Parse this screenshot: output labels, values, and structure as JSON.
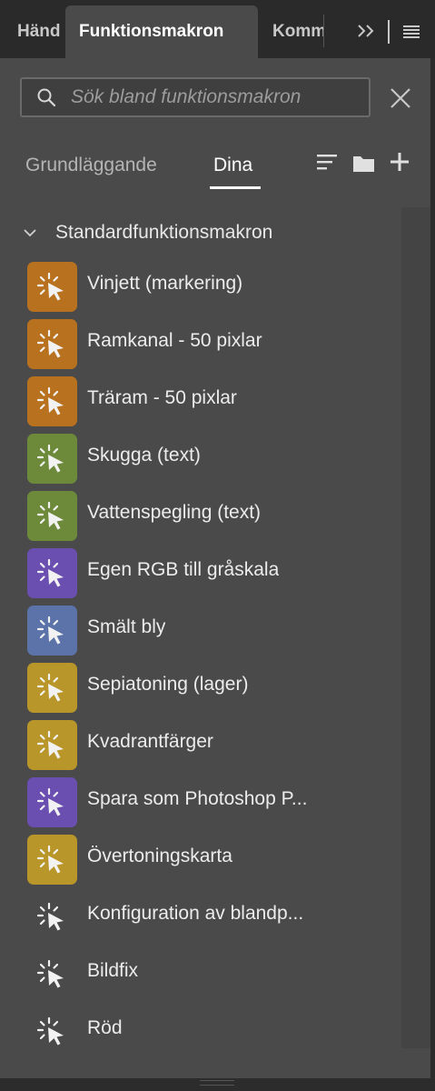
{
  "tabs": [
    {
      "label": "Händ"
    },
    {
      "label": "Funktionsmakron"
    },
    {
      "label": "Komm"
    }
  ],
  "search": {
    "placeholder": "Sök bland funktionsmakron",
    "value": ""
  },
  "subtabs": {
    "basic": "Grundläggande",
    "yours": "Dina"
  },
  "group": {
    "label": "Standardfunktionsmakron"
  },
  "colors": {
    "orange": "#b8721f",
    "green": "#6d8a3a",
    "purple": "#6a4fb0",
    "blue": "#5b73a8",
    "gold": "#b8962a"
  },
  "macros": [
    {
      "label": "Vinjett (markering)",
      "color": "#b8721f",
      "icon": "macro-cursor-icon"
    },
    {
      "label": "Ramkanal - 50 pixlar",
      "color": "#b8721f",
      "icon": "macro-cursor-icon"
    },
    {
      "label": "Träram - 50 pixlar",
      "color": "#b8721f",
      "icon": "macro-cursor-icon"
    },
    {
      "label": "Skugga (text)",
      "color": "#6d8a3a",
      "icon": "macro-cursor-icon"
    },
    {
      "label": "Vattenspegling (text)",
      "color": "#6d8a3a",
      "icon": "macro-cursor-icon"
    },
    {
      "label": "Egen RGB till gråskala",
      "color": "#6a4fb0",
      "icon": "macro-cursor-icon"
    },
    {
      "label": "Smält bly",
      "color": "#5b73a8",
      "icon": "macro-cursor-icon"
    },
    {
      "label": "Sepiatoning (lager)",
      "color": "#b8962a",
      "icon": "macro-cursor-icon"
    },
    {
      "label": "Kvadrantfärger",
      "color": "#b8962a",
      "icon": "macro-cursor-icon"
    },
    {
      "label": "Spara som Photoshop P...",
      "color": "#6a4fb0",
      "icon": "macro-cursor-icon"
    },
    {
      "label": "Övertoningskarta",
      "color": "#b8962a",
      "icon": "macro-cursor-icon"
    },
    {
      "label": "Konfiguration av blandp...",
      "color": "",
      "icon": "macro-cursor-icon"
    },
    {
      "label": "Bildfix",
      "color": "",
      "icon": "macro-cursor-icon"
    },
    {
      "label": "Röd",
      "color": "",
      "icon": "macro-cursor-icon"
    }
  ]
}
